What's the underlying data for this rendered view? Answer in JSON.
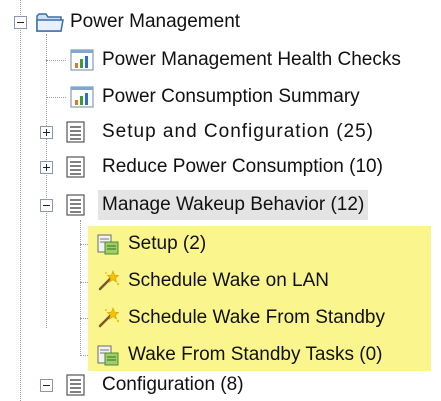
{
  "tree": {
    "root": {
      "label": "Power Management",
      "icon": "folder-icon",
      "expanded": true
    },
    "items": [
      {
        "label": "Power Management Health Checks",
        "icon": "report-chart-icon"
      },
      {
        "label": "Power Consumption Summary",
        "icon": "report-chart-icon"
      },
      {
        "label": "Setup and Configuration (25)",
        "icon": "list-icon",
        "expanded": false
      },
      {
        "label": "Reduce Power Consumption (10)",
        "icon": "list-icon",
        "expanded": false
      },
      {
        "label": "Manage Wakeup Behavior (12)",
        "icon": "list-icon",
        "expanded": true,
        "selected": true,
        "children": [
          {
            "label": "Setup (2)",
            "icon": "task-folder-icon"
          },
          {
            "label": "Schedule Wake on LAN",
            "icon": "magic-wand-icon"
          },
          {
            "label": "Schedule Wake From Standby",
            "icon": "magic-wand-icon"
          },
          {
            "label": "Wake From Standby Tasks (0)",
            "icon": "task-folder-icon"
          }
        ]
      },
      {
        "label": "Configuration (8)",
        "icon": "list-icon",
        "expanded": true
      }
    ]
  },
  "colors": {
    "highlight": "#fbf58d",
    "selection": "#e4e4e4",
    "connector": "#9a9a9a"
  }
}
